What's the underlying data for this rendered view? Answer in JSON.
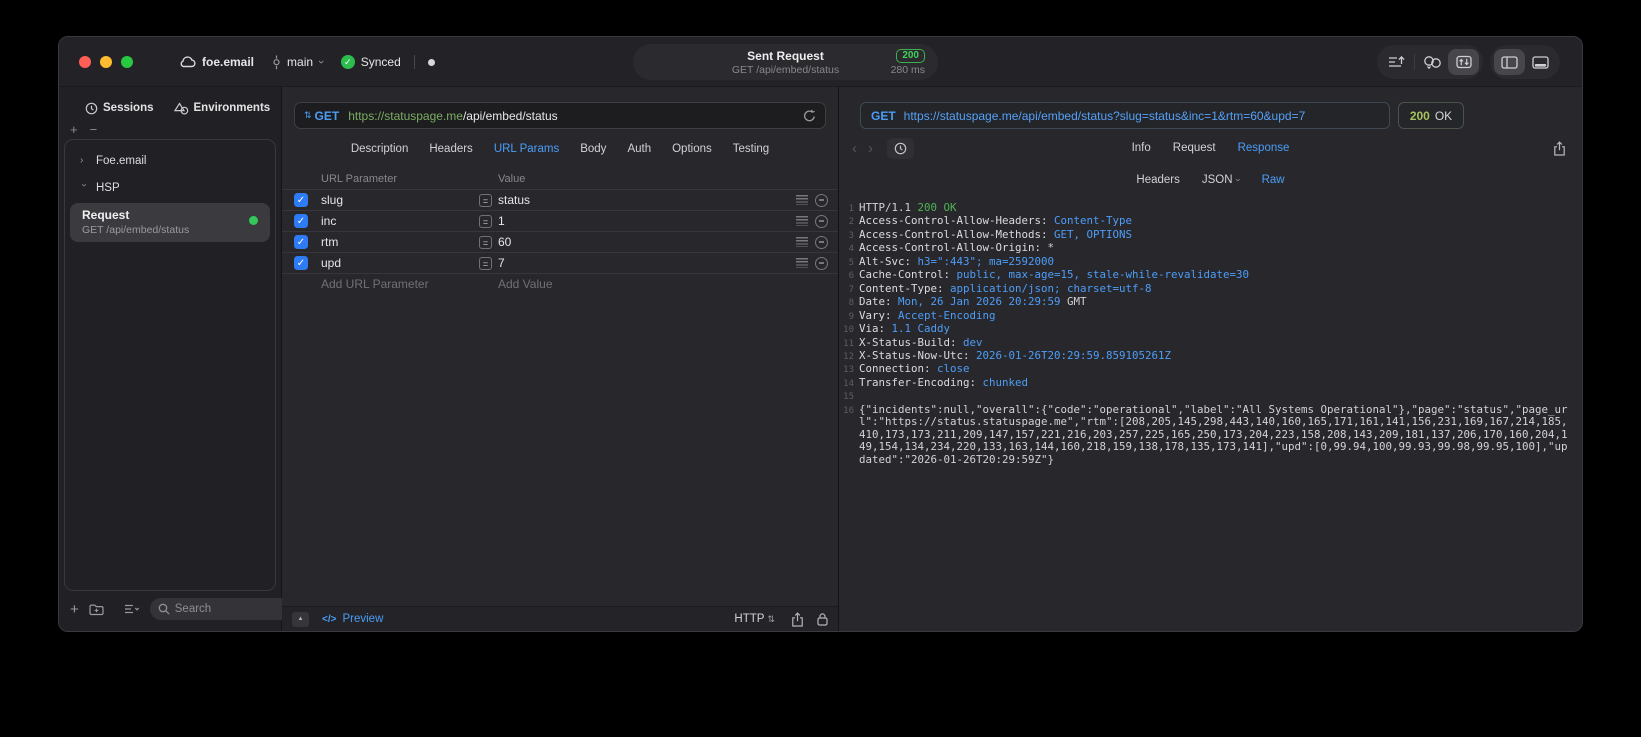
{
  "titlebar": {
    "project_name": "foe.email",
    "branch_name": "main",
    "sync_label": "Synced",
    "center": {
      "title": "Sent Request",
      "subtitle": "GET /api/embed/status",
      "status_code": "200",
      "duration": "280 ms"
    }
  },
  "sidebar": {
    "tabs": [
      {
        "label": "Sessions",
        "icon": "clock-icon"
      },
      {
        "label": "Environments",
        "icon": "shapes-icon"
      }
    ],
    "tree": [
      {
        "label": "Foe.email",
        "expanded": false
      },
      {
        "label": "HSP",
        "expanded": true
      }
    ],
    "selected_request": {
      "title": "Request",
      "subtitle": "GET /api/embed/status"
    },
    "search_placeholder": "Search"
  },
  "request_editor": {
    "method": "GET",
    "url_host": "https://statuspage.me",
    "url_path": "/api/embed/status",
    "tabs": [
      "Description",
      "Headers",
      "URL Params",
      "Body",
      "Auth",
      "Options",
      "Testing"
    ],
    "active_tab": "URL Params",
    "params": {
      "col_name": "URL Parameter",
      "col_value": "Value",
      "rows": [
        {
          "name": "slug",
          "value": "status",
          "enabled": true
        },
        {
          "name": "inc",
          "value": "1",
          "enabled": true
        },
        {
          "name": "rtm",
          "value": "60",
          "enabled": true
        },
        {
          "name": "upd",
          "value": "7",
          "enabled": true
        }
      ],
      "add_name": "Add URL Parameter",
      "add_value": "Add Value"
    },
    "footer": {
      "code_glyph": "</>",
      "preview": "Preview",
      "protocol": "HTTP"
    }
  },
  "response_viewer": {
    "method": "GET",
    "url": "https://statuspage.me/api/embed/status?slug=status&inc=1&rtm=60&upd=7",
    "status_code": "200",
    "status_text": "OK",
    "tabs": [
      "Info",
      "Request",
      "Response"
    ],
    "active_tab": "Response",
    "subtabs": [
      {
        "label": "Headers"
      },
      {
        "label": "JSON",
        "dropdown": true
      },
      {
        "label": "Raw",
        "active": true
      }
    ],
    "body_lines": [
      {
        "n": 1,
        "seg": [
          [
            "HTTP/1.1 ",
            "p"
          ],
          [
            "200 OK",
            "g"
          ]
        ]
      },
      {
        "n": 2,
        "seg": [
          [
            "Access-Control-Allow-Headers: ",
            "n"
          ],
          [
            "Content-Type",
            "v"
          ]
        ]
      },
      {
        "n": 3,
        "seg": [
          [
            "Access-Control-Allow-Methods: ",
            "n"
          ],
          [
            "GET, OPTIONS",
            "v"
          ]
        ]
      },
      {
        "n": 4,
        "seg": [
          [
            "Access-Control-Allow-Origin: ",
            "n"
          ],
          [
            "*",
            "p"
          ]
        ]
      },
      {
        "n": 5,
        "seg": [
          [
            "Alt-Svc: ",
            "n"
          ],
          [
            "h3=\":443\"; ma=2592000",
            "v"
          ]
        ]
      },
      {
        "n": 6,
        "seg": [
          [
            "Cache-Control: ",
            "n"
          ],
          [
            "public, max-age=15, stale-while-revalidate=30",
            "v"
          ]
        ]
      },
      {
        "n": 7,
        "seg": [
          [
            "Content-Type: ",
            "n"
          ],
          [
            "application/json; charset=utf-8",
            "v"
          ]
        ]
      },
      {
        "n": 8,
        "seg": [
          [
            "Date: ",
            "n"
          ],
          [
            "Mon, 26 Jan 2026 20:29:59",
            "v"
          ],
          [
            " GMT",
            "p"
          ]
        ]
      },
      {
        "n": 9,
        "seg": [
          [
            "Vary: ",
            "n"
          ],
          [
            "Accept-Encoding",
            "v"
          ]
        ]
      },
      {
        "n": 10,
        "seg": [
          [
            "Via: ",
            "n"
          ],
          [
            "1.1 Caddy",
            "v"
          ]
        ]
      },
      {
        "n": 11,
        "seg": [
          [
            "X-Status-Build: ",
            "n"
          ],
          [
            "dev",
            "v"
          ]
        ]
      },
      {
        "n": 12,
        "seg": [
          [
            "X-Status-Now-Utc: ",
            "n"
          ],
          [
            "2026-01-26T20:29:59.859105261Z",
            "v"
          ]
        ]
      },
      {
        "n": 13,
        "seg": [
          [
            "Connection: ",
            "n"
          ],
          [
            "close",
            "v"
          ]
        ]
      },
      {
        "n": 14,
        "seg": [
          [
            "Transfer-Encoding: ",
            "n"
          ],
          [
            "chunked",
            "v"
          ]
        ]
      },
      {
        "n": 15,
        "seg": []
      },
      {
        "n": 16,
        "seg": [
          [
            "{\"incidents\":null,\"overall\":{\"code\":\"operational\",\"label\":\"All Systems Operational\"},\"page\":\"status\",\"page_url\":\"https://status.statuspage.me\",\"rtm\":[208,205,145,298,443,140,160,165,171,161,141,156,231,169,167,214,185,410,173,173,211,209,147,157,221,216,203,257,225,165,250,173,204,223,158,208,143,209,181,137,206,170,160,204,149,154,134,234,220,133,163,144,160,218,159,138,178,135,173,141],\"upd\":[0,99.94,100,99.93,99.98,99.95,100],\"updated\":\"2026-01-26T20:29:59Z\"}",
            "p"
          ]
        ]
      }
    ]
  },
  "colors": {
    "accent_blue": "#4a9df7",
    "url_host_green": "#7cac62",
    "badge_green": "#40d15c",
    "status_code_green": "#a5c35d",
    "code_value_blue": "#4d9df8",
    "code_ok_green": "#4fb257",
    "checkbox_blue": "#2e7bf6",
    "traffic_red": "#ff5f57",
    "traffic_yellow": "#febc2e",
    "traffic_green": "#28c840"
  }
}
